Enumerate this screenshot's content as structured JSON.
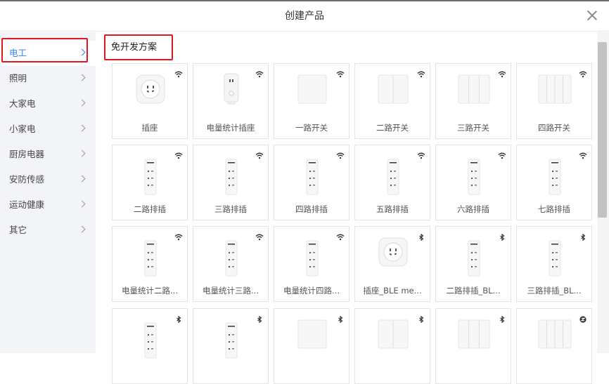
{
  "dialog": {
    "title": "创建产品"
  },
  "sidebar": {
    "items": [
      {
        "label": "电工",
        "active": true
      },
      {
        "label": "照明"
      },
      {
        "label": "大家电"
      },
      {
        "label": "小家电"
      },
      {
        "label": "厨房电器"
      },
      {
        "label": "安防传感"
      },
      {
        "label": "运动健康"
      },
      {
        "label": "其它"
      }
    ]
  },
  "section": {
    "title": "免开发方案"
  },
  "products": [
    {
      "name": "插座",
      "connectivity": "wifi-icon",
      "image": "socket"
    },
    {
      "name": "电量统计插座",
      "connectivity": "wifi-icon",
      "image": "plug"
    },
    {
      "name": "一路开关",
      "connectivity": "wifi-icon",
      "image": "switch1"
    },
    {
      "name": "二路开关",
      "connectivity": "wifi-icon",
      "image": "switch2"
    },
    {
      "name": "三路开关",
      "connectivity": "wifi-icon",
      "image": "switch3"
    },
    {
      "name": "四路开关",
      "connectivity": "wifi-icon",
      "image": "switch4"
    },
    {
      "name": "二路排插",
      "connectivity": "wifi-icon",
      "image": "strip"
    },
    {
      "name": "三路排插",
      "connectivity": "wifi-icon",
      "image": "strip"
    },
    {
      "name": "四路排插",
      "connectivity": "wifi-icon",
      "image": "strip"
    },
    {
      "name": "五路排插",
      "connectivity": "wifi-icon",
      "image": "strip"
    },
    {
      "name": "六路排插",
      "connectivity": "wifi-icon",
      "image": "strip"
    },
    {
      "name": "七路排插",
      "connectivity": "wifi-icon",
      "image": "strip"
    },
    {
      "name": "电量统计二路...",
      "connectivity": "wifi-icon",
      "image": "strip"
    },
    {
      "name": "电量统计三路...",
      "connectivity": "wifi-icon",
      "image": "strip"
    },
    {
      "name": "电量统计四路...",
      "connectivity": "wifi-icon",
      "image": "strip"
    },
    {
      "name": "插座_BLE me...",
      "connectivity": "bluetooth-icon",
      "image": "socket"
    },
    {
      "name": "二路排插_BL...",
      "connectivity": "bluetooth-icon",
      "image": "strip"
    },
    {
      "name": "三路排插_BL...",
      "connectivity": "bluetooth-icon",
      "image": "strip"
    },
    {
      "name": "",
      "connectivity": "bluetooth-icon",
      "image": "strip"
    },
    {
      "name": "",
      "connectivity": "bluetooth-icon",
      "image": "strip"
    },
    {
      "name": "",
      "connectivity": "bluetooth-icon",
      "image": "switch1"
    },
    {
      "name": "",
      "connectivity": "bluetooth-icon",
      "image": "switch2"
    },
    {
      "name": "",
      "connectivity": "bluetooth-icon",
      "image": "switch3"
    },
    {
      "name": "",
      "connectivity": "zigbee-icon",
      "image": "switch4"
    }
  ],
  "colors": {
    "accent": "#2f86f6",
    "highlight": "#e0191f",
    "sidebar_bg": "#f2f4f7"
  }
}
